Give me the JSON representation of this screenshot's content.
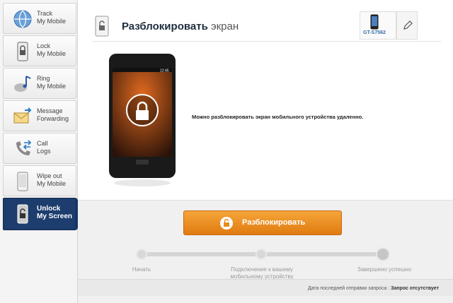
{
  "sidebar": {
    "items": [
      {
        "label": "Track\nMy Mobile",
        "icon": "globe-icon"
      },
      {
        "label": "Lock\nMy Mobile",
        "icon": "lock-phone-icon"
      },
      {
        "label": "Ring\nMy Mobile",
        "icon": "music-note-icon"
      },
      {
        "label": "Message\nForwarding",
        "icon": "envelope-icon"
      },
      {
        "label": "Call\nLogs",
        "icon": "phone-arrows-icon"
      },
      {
        "label": "Wipe out\nMy Mobile",
        "icon": "eraser-icon"
      },
      {
        "label": "Unlock\nMy Screen",
        "icon": "unlock-phone-icon",
        "active": true
      }
    ]
  },
  "header": {
    "title_bold": "Разблокировать",
    "title_rest": " экран",
    "device_model": "GT-S7562"
  },
  "main": {
    "description": "Можно разблокировать экран мобильного устройства удаленно.",
    "phone_time": "12:45"
  },
  "action": {
    "button_label": "Разблокировать",
    "steps": [
      "Начать",
      "Подключение к вашему мобильному устройству",
      "Завершено успешно"
    ],
    "status_label": "Дата последней отправки запроса :",
    "status_value": "Запрос отсутствует"
  },
  "colors": {
    "accent": "#1c3d6d",
    "button": "#e88a1c"
  }
}
